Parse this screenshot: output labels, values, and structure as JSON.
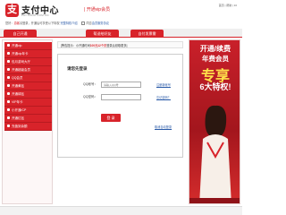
{
  "header": {
    "logo_glyph": "支",
    "title": "支付中心",
    "subtitle": "PAY.SOHU.COM.CN",
    "slogan": "| 开通vip会员",
    "top_links": "首页 | 帮助 | 10"
  },
  "userbar": {
    "prefix": "您好：",
    "user": "游客",
    "text": "请登录，开通后可享受以下特权",
    "link": "完整特权介绍",
    "checkbox_label": "同意",
    "agreement_link": "会员服务协议"
  },
  "tabs": [
    "自己开通",
    "帮送给好友",
    "自付发票需"
  ],
  "sidebar": {
    "items": [
      "开通vip",
      "开通vip年卡",
      "包月游戏大厅",
      "开通超级会员",
      "QQ会员",
      "开通黄钻",
      "开通绿钻",
      "VIP年卡",
      "小开通/CP",
      "开通红钻",
      "充值到余额"
    ]
  },
  "notice": {
    "text1": "[警告提示：小开通时间",
    "highlight": "100元12个月",
    "text2": "登录后领取更多]"
  },
  "login": {
    "title": "请您先登录",
    "account_label": "QQ帐号：",
    "account_placeholder": "请输入QQ号",
    "password_label": "QQ密码：",
    "register_link": "注册新帐号",
    "forgot_link": "忘记密码？",
    "submit_label": "登 录",
    "cancel_link": "取消自动登录"
  },
  "ad": {
    "line1": "开通/续费",
    "line2": "年费会员",
    "big": "专享",
    "discount": "6大特权!"
  },
  "colors": {
    "brand_red": "#d8232a",
    "link_blue": "#2a5aa8",
    "ad_yellow": "#ffe14a"
  },
  "icons": [
    "wallet-logo-icon",
    "menu-dot-icon"
  ]
}
